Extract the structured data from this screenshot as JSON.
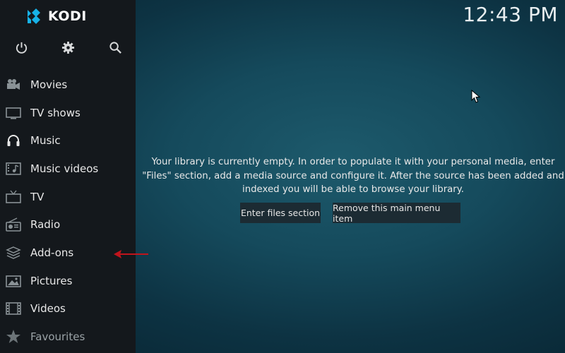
{
  "app": {
    "logo_text": "KODI"
  },
  "clock": "12:43 PM",
  "top_buttons": [
    {
      "icon": "power-icon"
    },
    {
      "icon": "gear-icon"
    },
    {
      "icon": "search-icon"
    }
  ],
  "menu": {
    "items": [
      {
        "label": "Movies",
        "icon": "movie-camera-icon"
      },
      {
        "label": "TV shows",
        "icon": "tv-icon"
      },
      {
        "label": "Music",
        "icon": "headphones-icon"
      },
      {
        "label": "Music videos",
        "icon": "music-video-icon"
      },
      {
        "label": "TV",
        "icon": "tv-antenna-icon"
      },
      {
        "label": "Radio",
        "icon": "radio-icon"
      },
      {
        "label": "Add-ons",
        "icon": "addons-box-icon"
      },
      {
        "label": "Pictures",
        "icon": "picture-icon"
      },
      {
        "label": "Videos",
        "icon": "film-strip-icon"
      },
      {
        "label": "Favourites",
        "icon": "star-icon"
      }
    ]
  },
  "main": {
    "message_lines": [
      "Your library is currently empty. In order to populate it with your personal media, enter",
      "\"Files\" section, add a media source and configure it. After the source has been added and",
      "indexed you will be able to browse your library."
    ],
    "enter_files_label": "Enter files section",
    "remove_item_label": "Remove this main menu item"
  },
  "colors": {
    "sidebar_bg": "#14181c",
    "content_bg": "#154a5c",
    "kodi_blue": "#17b2e8",
    "annotation_arrow": "#c0141c"
  }
}
